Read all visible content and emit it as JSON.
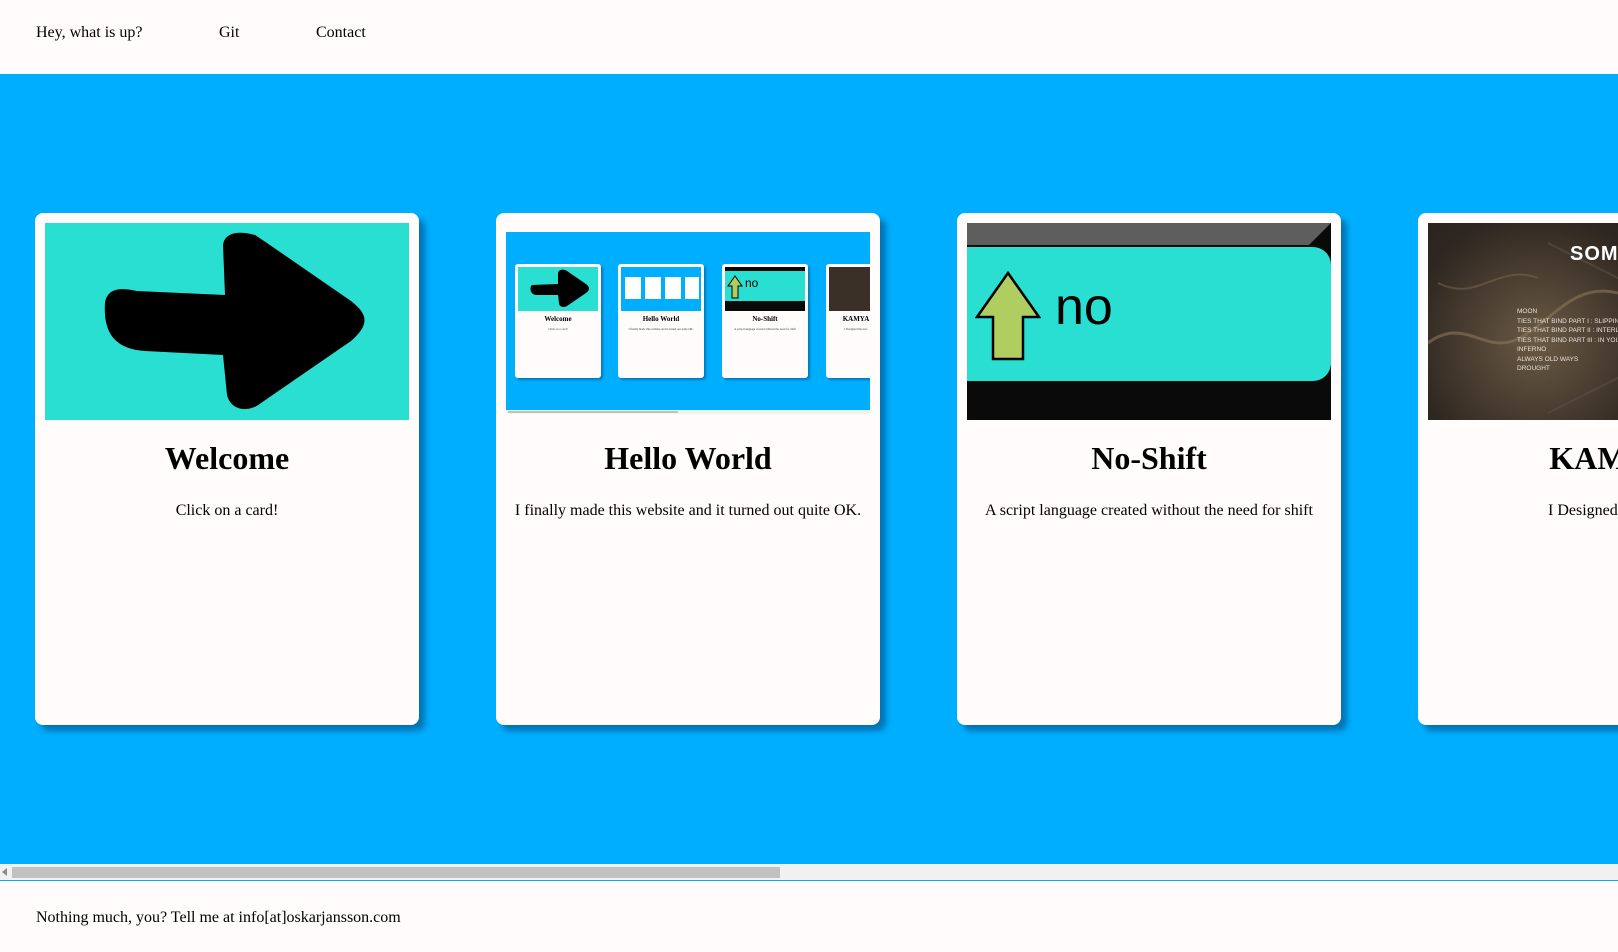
{
  "nav": {
    "home": "Hey, what is up?",
    "git": "Git",
    "contact": "Contact"
  },
  "cards": [
    {
      "title": "Welcome",
      "desc": "Click on a card!"
    },
    {
      "title": "Hello World",
      "desc": "I finally made this website and it turned out quite OK."
    },
    {
      "title": "No-Shift",
      "desc": "A script language created without the need for shift"
    },
    {
      "title": "KAMYA",
      "desc": "I Designed the new"
    }
  ],
  "thumbs": {
    "noshift_text": "no",
    "kamya_brand": "SOM",
    "kamya_tracks": [
      "MOON",
      "TIES THAT BIND PART I : SLIPPING",
      "TIES THAT BIND PART II : INTERLUD",
      "TIES THAT BIND PART III : IN YOUR",
      "INFERNO",
      "ALWAYS OLD WAYS",
      "DROUGHT"
    ]
  },
  "footer": {
    "text": "Nothing much, you? Tell me at info[at]oskarjansson.com"
  },
  "colors": {
    "band": "#00aeff",
    "card": "#fffcfb",
    "teal": "#29dfd1",
    "arrow_green": "#b0cd5f"
  }
}
